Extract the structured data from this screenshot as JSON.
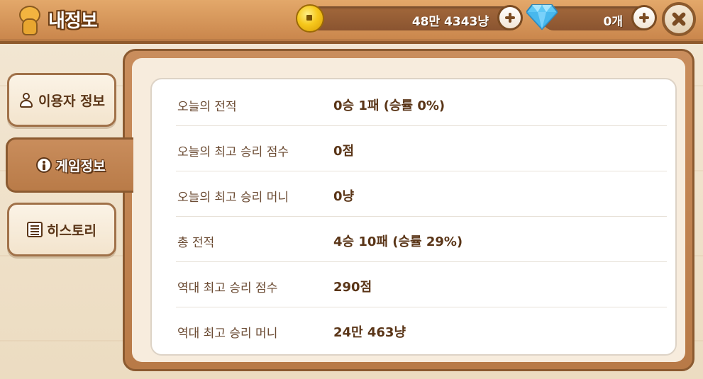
{
  "header": {
    "title": "내정보",
    "gold_amount": "48만 4343냥",
    "gem_amount": "0개"
  },
  "tabs": [
    {
      "label": "이용자 정보",
      "icon": "user-icon",
      "active": false
    },
    {
      "label": "게임정보",
      "icon": "info-icon",
      "active": true
    },
    {
      "label": "히스토리",
      "icon": "list-icon",
      "active": false
    }
  ],
  "stats": [
    {
      "label": "오늘의 전적",
      "value": "0승 1패 (승률 0%)"
    },
    {
      "label": "오늘의 최고 승리 점수",
      "value": "0점"
    },
    {
      "label": "오늘의 최고 승리 머니",
      "value": "0냥"
    },
    {
      "label": "총 전적",
      "value": "4승 10패 (승률 29%)"
    },
    {
      "label": "역대 최고 승리 점수",
      "value": "290점"
    },
    {
      "label": "역대 최고 승리 머니",
      "value": "24만 463냥"
    }
  ],
  "colors": {
    "wood_dark": "#8b5a30",
    "wood_light": "#c98d5c",
    "text_brown": "#5a3517",
    "coin_gold": "#f6c81c",
    "gem_blue": "#5ec8f5"
  }
}
